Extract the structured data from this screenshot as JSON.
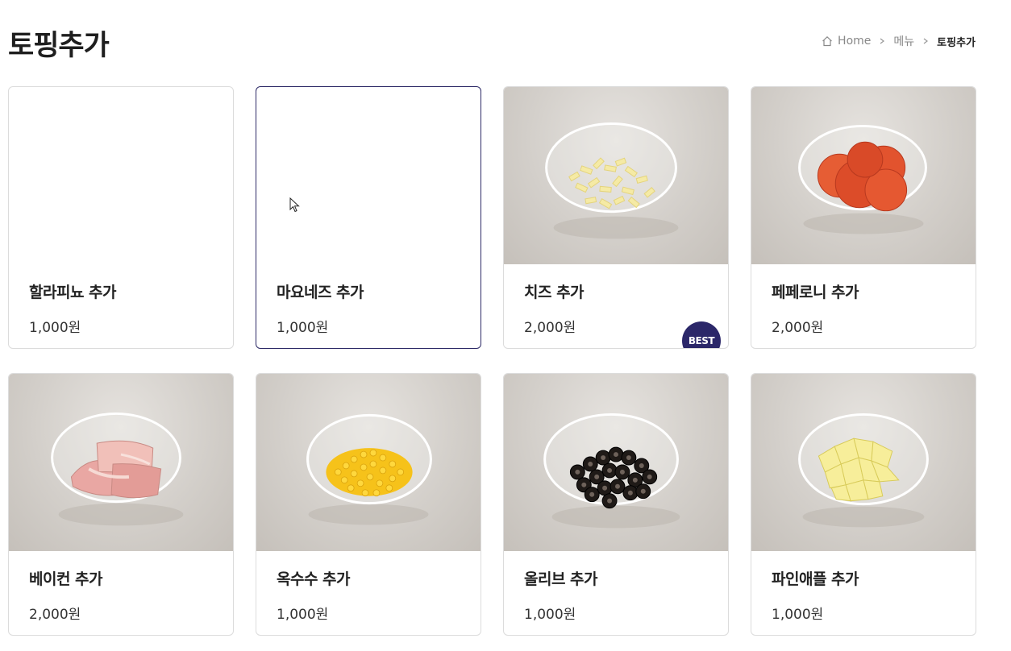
{
  "page": {
    "title": "토핑추가"
  },
  "breadcrumb": {
    "home": "Home",
    "menu": "메뉴",
    "current": "토핑추가"
  },
  "products": [
    {
      "name": "할라피뇨 추가",
      "price": "1,000원",
      "image": "none",
      "badge": ""
    },
    {
      "name": "마요네즈 추가",
      "price": "1,000원",
      "image": "none",
      "badge": ""
    },
    {
      "name": "치즈 추가",
      "price": "2,000원",
      "image": "cheese-bowl",
      "badge": "BEST"
    },
    {
      "name": "페페로니 추가",
      "price": "2,000원",
      "image": "pepperoni-bowl",
      "badge": ""
    },
    {
      "name": "베이컨 추가",
      "price": "2,000원",
      "image": "bacon-bowl",
      "badge": ""
    },
    {
      "name": "옥수수 추가",
      "price": "1,000원",
      "image": "corn-bowl",
      "badge": ""
    },
    {
      "name": "올리브 추가",
      "price": "1,000원",
      "image": "olive-bowl",
      "badge": ""
    },
    {
      "name": "파인애플 추가",
      "price": "1,000원",
      "image": "pineapple-bowl",
      "badge": ""
    }
  ],
  "theme": {
    "accent": "#2b2769",
    "card_border": "#dcdcdc"
  }
}
